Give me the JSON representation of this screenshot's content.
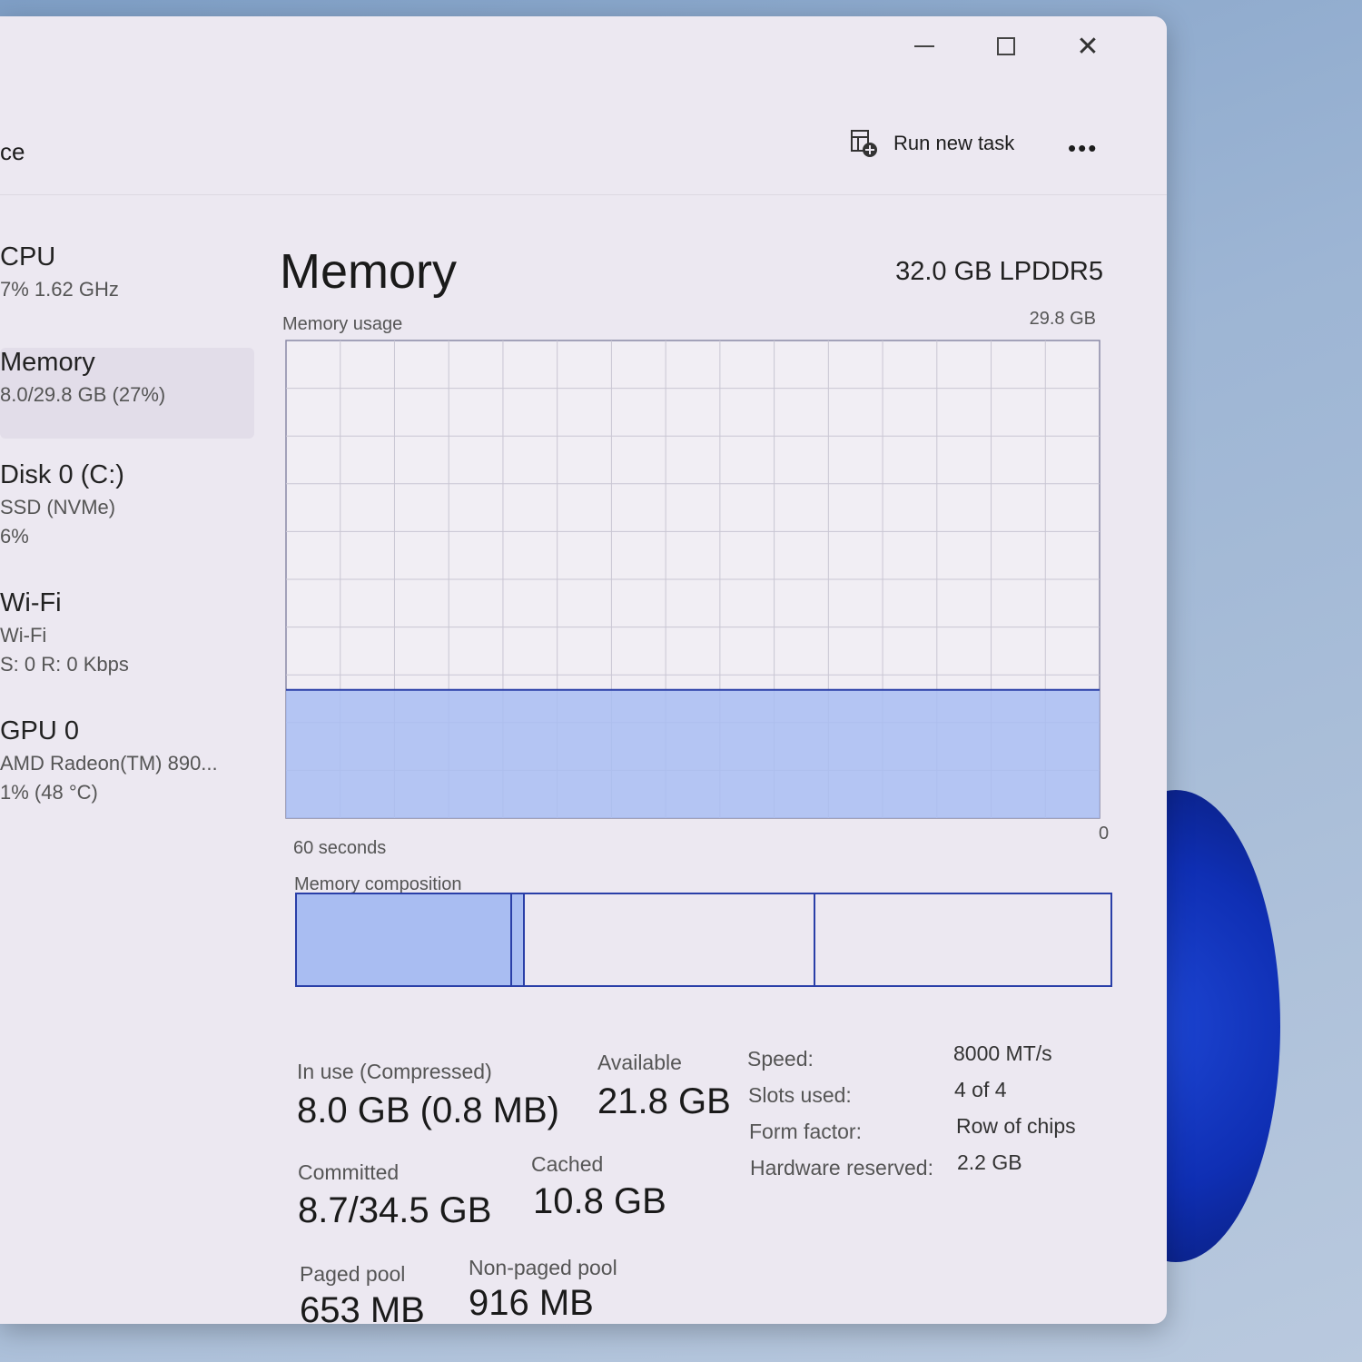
{
  "window": {
    "controls": {
      "minimize": "",
      "maximize": "",
      "close": "✕"
    }
  },
  "toolbar": {
    "page_title": "ce",
    "run_new_task": "Run new task",
    "more": "•••"
  },
  "sidebar": {
    "items": [
      {
        "name": "CPU",
        "line1": "7%  1.62 GHz",
        "line2": ""
      },
      {
        "name": "Memory",
        "line1": "8.0/29.8 GB (27%)",
        "line2": ""
      },
      {
        "name": "Disk 0 (C:)",
        "line1": "SSD (NVMe)",
        "line2": "6%"
      },
      {
        "name": "Wi-Fi",
        "line1": "Wi-Fi",
        "line2": "S: 0  R: 0 Kbps"
      },
      {
        "name": "GPU 0",
        "line1": "AMD Radeon(TM) 890...",
        "line2": "1%  (48 °C)"
      }
    ]
  },
  "memory": {
    "title": "Memory",
    "spec": "32.0 GB LPDDR5",
    "usage_label": "Memory usage",
    "usage_max": "29.8 GB",
    "x_left": "60 seconds",
    "x_right": "0",
    "composition_label": "Memory composition",
    "stats": {
      "in_use_label": "In use (Compressed)",
      "in_use_value": "8.0 GB (0.8 MB)",
      "available_label": "Available",
      "available_value": "21.8 GB",
      "committed_label": "Committed",
      "committed_value": "8.7/34.5 GB",
      "cached_label": "Cached",
      "cached_value": "10.8 GB",
      "paged_label": "Paged pool",
      "paged_value": "653 MB",
      "nonpaged_label": "Non-paged pool",
      "nonpaged_value": "916 MB"
    },
    "details": [
      {
        "label": "Speed:",
        "value": "8000 MT/s"
      },
      {
        "label": "Slots used:",
        "value": "4 of 4"
      },
      {
        "label": "Form factor:",
        "value": "Row of chips"
      },
      {
        "label": "Hardware reserved:",
        "value": "2.2 GB"
      }
    ]
  },
  "chart_data": {
    "type": "area",
    "ylim": [
      0,
      29.8
    ],
    "x": [
      60,
      0
    ],
    "series": [
      {
        "values": [
          8.0,
          8.0
        ]
      }
    ],
    "composition_gb": {
      "in_use": 8.0,
      "modified": 0.5,
      "standby": 10.8,
      "free": 11.0
    }
  },
  "colors": {
    "accent": "#2a3fa8",
    "fill": "#a9bdf2",
    "grid": "#c9c6d3"
  }
}
